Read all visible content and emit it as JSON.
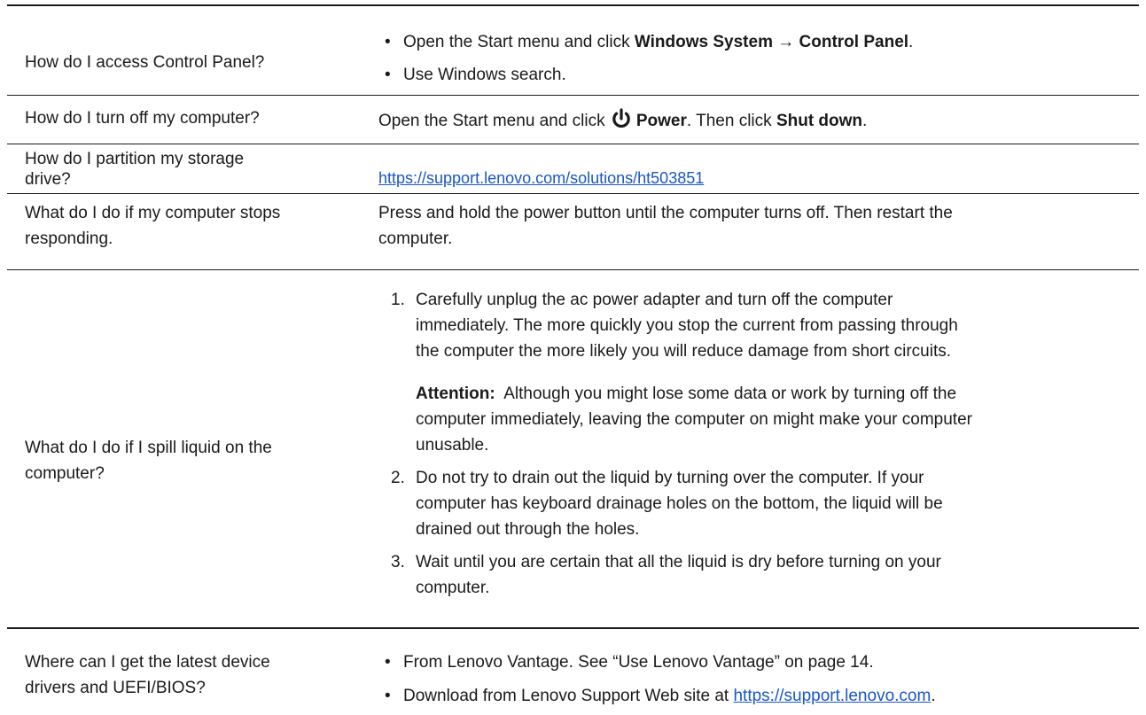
{
  "rows": [
    {
      "question": "How do I access Control Panel?",
      "bullets": [
        {
          "pre": "Open the Start menu and click ",
          "bold1": "Windows System",
          "arrow": "→",
          "bold2": "Control Panel",
          "post": "."
        },
        {
          "text": "Use Windows search."
        }
      ]
    },
    {
      "question": "How do I turn off my computer?",
      "answer": {
        "pre": "Open the Start menu and click ",
        "icon": "power-icon",
        "bold1": "Power",
        "mid": ". Then click ",
        "bold2": "Shut down",
        "post": "."
      }
    },
    {
      "question_line1": "How do I partition my storage",
      "question_line2": "drive?",
      "link": "https://support.lenovo.com/solutions/ht503851"
    },
    {
      "question_line1": "What do I do if my computer stops",
      "question_line2": "responding.",
      "answer_line1": "Press and hold the power button until the computer turns off. Then restart the",
      "answer_line2": "computer."
    },
    {
      "question_line1": "What do I do if I spill liquid on the",
      "question_line2": "computer?",
      "steps": [
        {
          "num": "1.",
          "l1": "Carefully unplug the ac power adapter and turn off the computer",
          "l2": "immediately. The more quickly you stop the current from passing through",
          "l3": "the computer the more likely you will reduce damage from short circuits."
        },
        {
          "num": "2.",
          "l1": "Do not try to drain out the liquid by turning over the computer. If your",
          "l2": "computer has keyboard drainage holes on the bottom, the liquid will be",
          "l3": "drained out through the holes."
        },
        {
          "num": "3.",
          "l1": "Wait until you are certain that all the liquid is dry before turning on your",
          "l2": "computer."
        }
      ],
      "attention_label": "Attention:",
      "attention_l1": "Although you might lose some data or work by turning off the",
      "attention_l2": "computer immediately, leaving the computer on might make your computer",
      "attention_l3": "unusable."
    },
    {
      "question_line1": "Where can I get the latest device",
      "question_line2": "drivers and UEFI/BIOS?",
      "bullet1": "From Lenovo Vantage. See “Use Lenovo Vantage” on page 14.",
      "bullet2_pre": "Download from Lenovo Support Web site at ",
      "bullet2_link": "https://support.lenovo.com",
      "bullet2_post": "."
    }
  ]
}
